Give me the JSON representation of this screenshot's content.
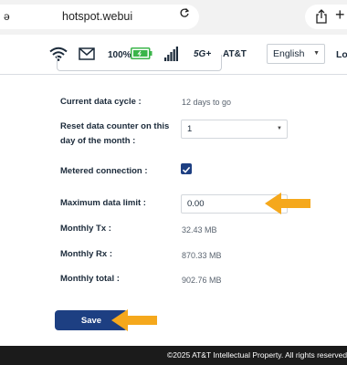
{
  "browser": {
    "url_leading": "ə",
    "url": "hotspot.webui",
    "plus_label": "+"
  },
  "status": {
    "battery_percent": "100%",
    "network_type": "5G+",
    "carrier": "AT&T",
    "language": "English",
    "login_label": "Lo"
  },
  "form": {
    "data_cycle_label": "Current data cycle :",
    "data_cycle_value": "12 days to go",
    "reset_day_label_line1": "Reset data counter on this",
    "reset_day_label_line2": "day of the month :",
    "reset_day_value": "1",
    "metered_label": "Metered connection :",
    "metered_checked": true,
    "max_limit_label": "Maximum data limit :",
    "max_limit_value": "0.00",
    "monthly_tx_label": "Monthly Tx :",
    "monthly_tx_value": "32.43 MB",
    "monthly_rx_label": "Monthly Rx :",
    "monthly_rx_value": "870.33 MB",
    "monthly_total_label": "Monthly total :",
    "monthly_total_value": "902.76 MB",
    "save_label": "Save"
  },
  "footer": {
    "copyright": "©2025 AT&T Intellectual Property. All rights reserved."
  },
  "colors": {
    "primary": "#1d3f82",
    "highlight_arrow": "#f5a81c",
    "battery_green": "#3bb54a",
    "footer_bg": "#1b1b1b"
  },
  "icons": [
    "reload-icon",
    "share-icon",
    "wifi-icon",
    "mail-icon",
    "battery-icon",
    "signal-icon",
    "checkmark-icon",
    "chevron-down-icon",
    "arrow-icon"
  ]
}
